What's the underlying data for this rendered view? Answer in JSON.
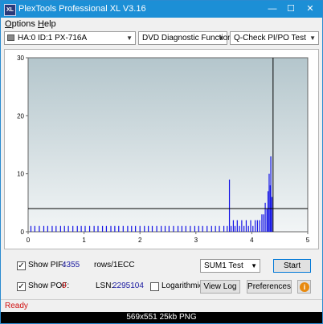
{
  "window": {
    "title": "PlexTools Professional XL V3.16",
    "app_icon_text": "XL",
    "min_symbol": "—",
    "max_symbol": "☐",
    "close_symbol": "✕"
  },
  "menu": {
    "options_first": "O",
    "options_rest": "ptions",
    "help_first": "H",
    "help_rest": "elp"
  },
  "toolbar": {
    "drive": "HA:0 ID:1  PX-716A",
    "function": "DVD Diagnostic Functions",
    "test": "Q-Check PI/PO Test",
    "arrow": "▼"
  },
  "chart_data": {
    "type": "bar",
    "x_range": [
      0,
      5
    ],
    "y_range": [
      0,
      30
    ],
    "x_ticks": [
      "0",
      "1",
      "2",
      "3",
      "4",
      "5"
    ],
    "y_ticks": [
      "0",
      "10",
      "20",
      "30"
    ],
    "threshold": 4,
    "end_marker": 4.38,
    "bars": [
      {
        "x": 0.05,
        "y": 1
      },
      {
        "x": 0.12,
        "y": 1
      },
      {
        "x": 0.2,
        "y": 1
      },
      {
        "x": 0.28,
        "y": 1
      },
      {
        "x": 0.35,
        "y": 1
      },
      {
        "x": 0.43,
        "y": 1
      },
      {
        "x": 0.5,
        "y": 1
      },
      {
        "x": 0.58,
        "y": 1
      },
      {
        "x": 0.65,
        "y": 1
      },
      {
        "x": 0.72,
        "y": 1
      },
      {
        "x": 0.8,
        "y": 1
      },
      {
        "x": 0.88,
        "y": 1
      },
      {
        "x": 0.95,
        "y": 1
      },
      {
        "x": 1.02,
        "y": 1
      },
      {
        "x": 1.1,
        "y": 1
      },
      {
        "x": 1.18,
        "y": 1
      },
      {
        "x": 1.25,
        "y": 1
      },
      {
        "x": 1.33,
        "y": 1
      },
      {
        "x": 1.4,
        "y": 1
      },
      {
        "x": 1.48,
        "y": 1
      },
      {
        "x": 1.55,
        "y": 1
      },
      {
        "x": 1.62,
        "y": 1
      },
      {
        "x": 1.7,
        "y": 1
      },
      {
        "x": 1.78,
        "y": 1
      },
      {
        "x": 1.85,
        "y": 1
      },
      {
        "x": 1.92,
        "y": 1
      },
      {
        "x": 2.0,
        "y": 1
      },
      {
        "x": 2.08,
        "y": 1
      },
      {
        "x": 2.15,
        "y": 1
      },
      {
        "x": 2.22,
        "y": 1
      },
      {
        "x": 2.3,
        "y": 1
      },
      {
        "x": 2.38,
        "y": 1
      },
      {
        "x": 2.45,
        "y": 1
      },
      {
        "x": 2.52,
        "y": 1
      },
      {
        "x": 2.6,
        "y": 1
      },
      {
        "x": 2.68,
        "y": 1
      },
      {
        "x": 2.75,
        "y": 1
      },
      {
        "x": 2.82,
        "y": 1
      },
      {
        "x": 2.9,
        "y": 1
      },
      {
        "x": 2.98,
        "y": 1
      },
      {
        "x": 3.05,
        "y": 1
      },
      {
        "x": 3.12,
        "y": 1
      },
      {
        "x": 3.2,
        "y": 1
      },
      {
        "x": 3.28,
        "y": 1
      },
      {
        "x": 3.35,
        "y": 1
      },
      {
        "x": 3.42,
        "y": 1
      },
      {
        "x": 3.5,
        "y": 1
      },
      {
        "x": 3.56,
        "y": 1
      },
      {
        "x": 3.6,
        "y": 9
      },
      {
        "x": 3.63,
        "y": 1
      },
      {
        "x": 3.67,
        "y": 2
      },
      {
        "x": 3.7,
        "y": 1
      },
      {
        "x": 3.74,
        "y": 2
      },
      {
        "x": 3.78,
        "y": 1
      },
      {
        "x": 3.82,
        "y": 2
      },
      {
        "x": 3.86,
        "y": 1
      },
      {
        "x": 3.9,
        "y": 2
      },
      {
        "x": 3.94,
        "y": 1
      },
      {
        "x": 3.98,
        "y": 2
      },
      {
        "x": 4.02,
        "y": 1
      },
      {
        "x": 4.06,
        "y": 2
      },
      {
        "x": 4.1,
        "y": 2
      },
      {
        "x": 4.14,
        "y": 2
      },
      {
        "x": 4.18,
        "y": 3
      },
      {
        "x": 4.21,
        "y": 3
      },
      {
        "x": 4.24,
        "y": 5
      },
      {
        "x": 4.27,
        "y": 4
      },
      {
        "x": 4.29,
        "y": 7
      },
      {
        "x": 4.31,
        "y": 10
      },
      {
        "x": 4.33,
        "y": 8
      },
      {
        "x": 4.34,
        "y": 13
      },
      {
        "x": 4.36,
        "y": 6
      }
    ]
  },
  "controls": {
    "show_pif_label": "Show PIF:",
    "pif_value": "4355",
    "pif_unit": "rows/1ECC",
    "show_pof_label": "Show POF:",
    "pof_value": "0",
    "lsn_label": "LSN:",
    "lsn_value": "2295104",
    "logarithmic_label": "Logarithmic",
    "test_select": "SUM1 Test",
    "start_button": "Start",
    "view_log_button": "View Log",
    "preferences_button": "Preferences",
    "check_mark": "✓",
    "info_glyph": "i"
  },
  "status": {
    "text": "Ready"
  },
  "caption": {
    "text": "569x551  25kb  PNG"
  },
  "colors": {
    "titlebar": "#1c8fd6",
    "bar": "#1414e6",
    "status_text": "#d01010"
  }
}
